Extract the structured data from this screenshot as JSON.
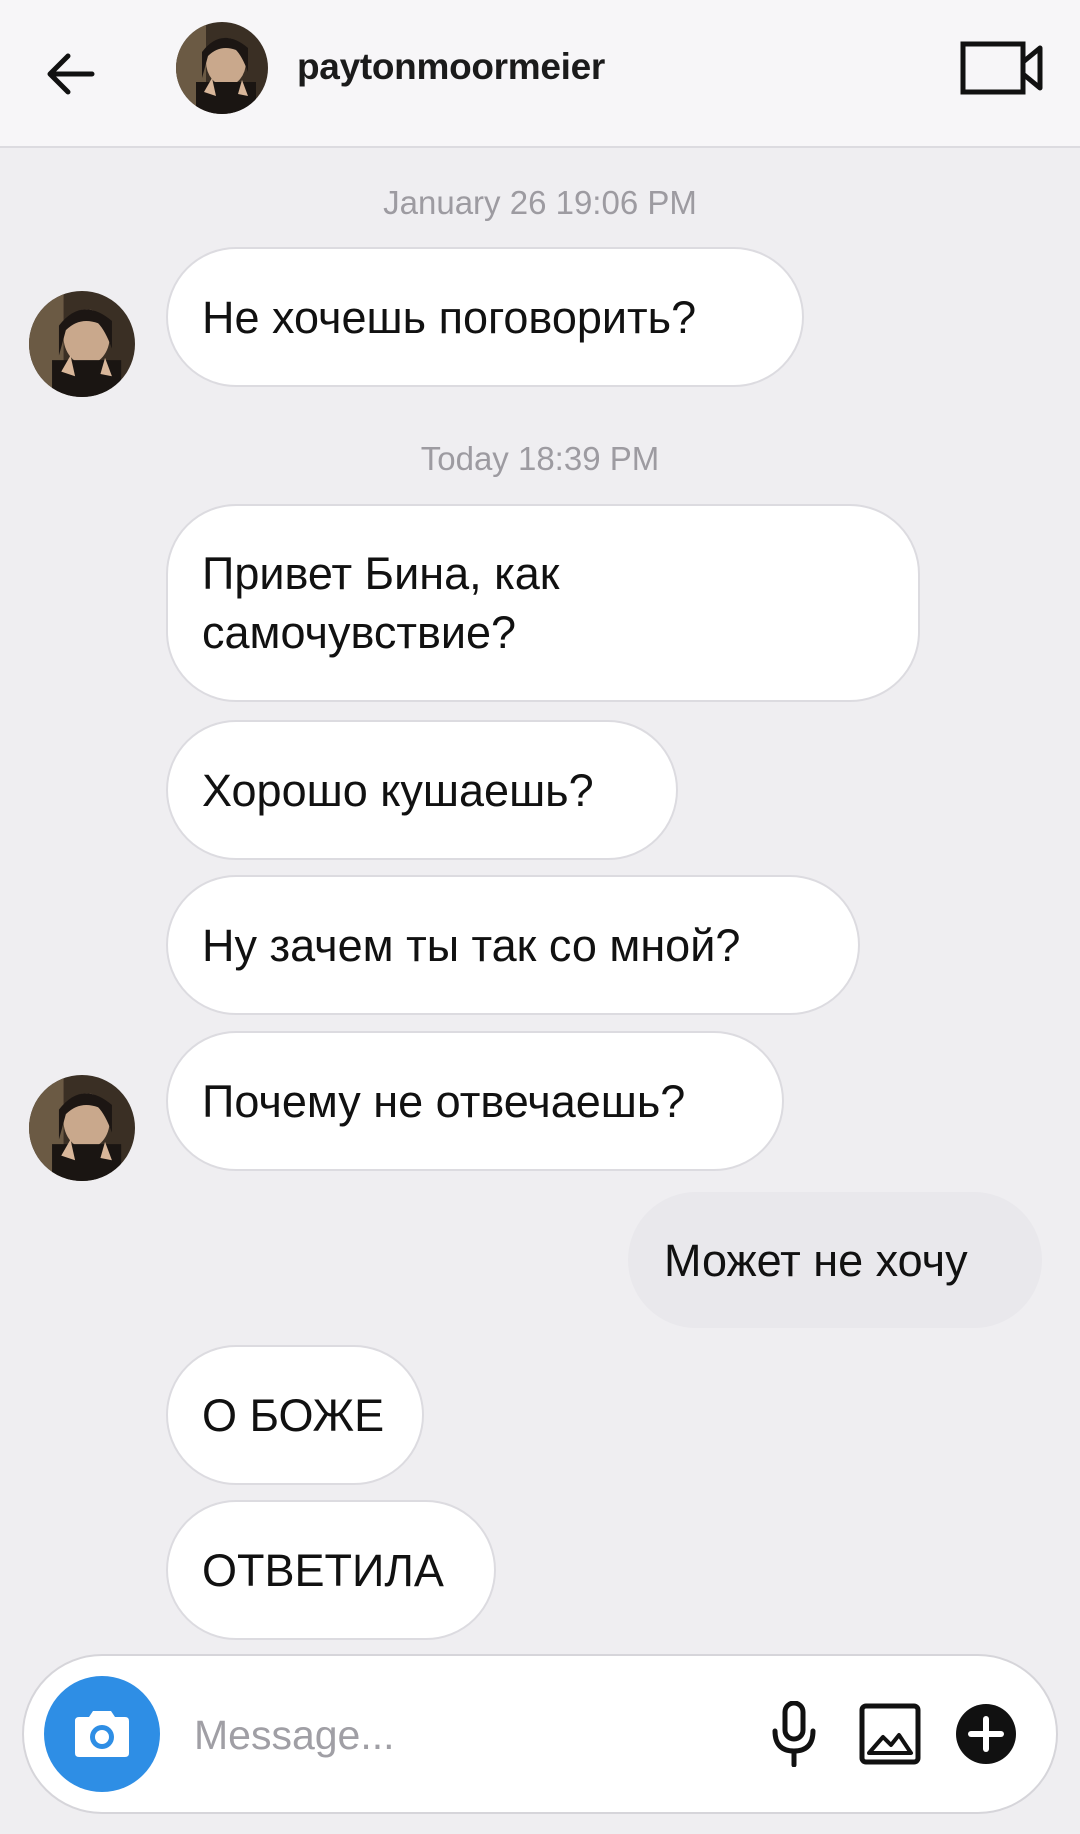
{
  "header": {
    "username": "paytonmoormeier",
    "back_icon": "arrow-left-icon",
    "video_icon": "video-camera-icon"
  },
  "thread": {
    "timestamps": [
      "January 26 19:06 PM",
      "Today 18:39 PM"
    ],
    "messages": [
      {
        "text": "Не хочешь поговорить?",
        "direction": "incoming",
        "avatar": true
      },
      {
        "text": "Привет Бина, как самочувствие?",
        "direction": "incoming",
        "avatar": false
      },
      {
        "text": "Хорошо кушаешь?",
        "direction": "incoming",
        "avatar": false
      },
      {
        "text": "Ну зачем ты так со мной?",
        "direction": "incoming",
        "avatar": false
      },
      {
        "text": "Почему не отвечаешь?",
        "direction": "incoming",
        "avatar": true
      },
      {
        "text": "Может не хочу",
        "direction": "outgoing",
        "avatar": false
      },
      {
        "text": "О БОЖЕ",
        "direction": "incoming",
        "avatar": false
      },
      {
        "text": "ОТВЕТИЛА",
        "direction": "incoming",
        "avatar": false
      }
    ]
  },
  "composer": {
    "placeholder": "Message...",
    "camera_icon": "camera-icon",
    "mic_icon": "microphone-icon",
    "gallery_icon": "gallery-icon",
    "plus_icon": "plus-circle-icon"
  },
  "colors": {
    "background": "#efeef1",
    "bubble_incoming": "#ffffff",
    "bubble_outgoing": "#e9e8ec",
    "accent": "#2e8ee5"
  }
}
